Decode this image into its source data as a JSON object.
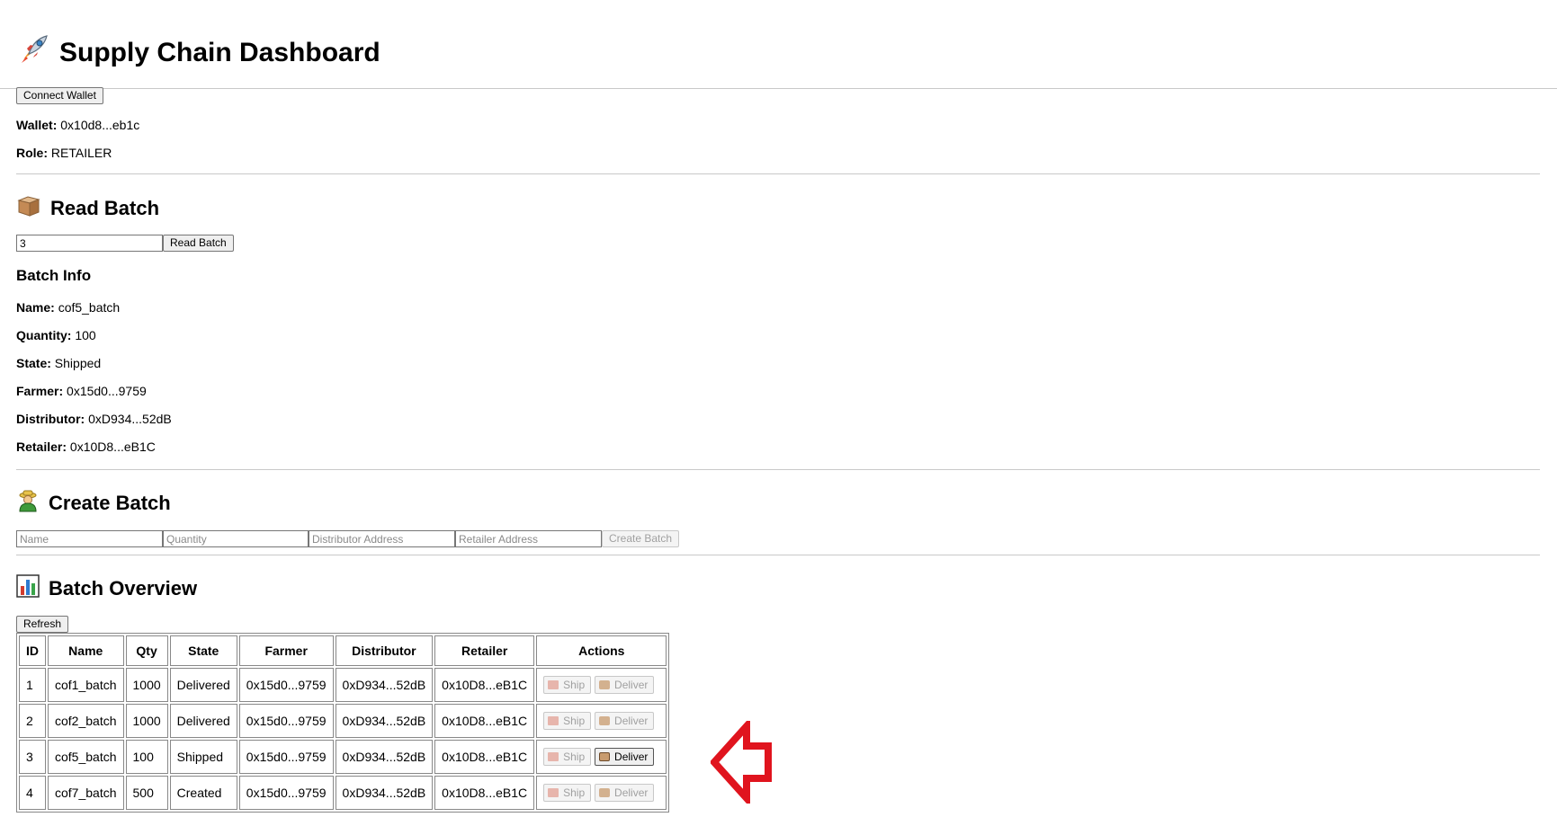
{
  "header": {
    "title": "Supply Chain Dashboard",
    "icon": "rocket-icon"
  },
  "wallet": {
    "connect_label": "Connect Wallet",
    "wallet_label": "Wallet:",
    "wallet_value": "0x10d8...eb1c",
    "role_label": "Role:",
    "role_value": "RETAILER"
  },
  "read_batch": {
    "heading": "Read Batch",
    "icon": "package-icon",
    "input_value": "3",
    "button_label": "Read Batch",
    "info_heading": "Batch Info",
    "fields": [
      {
        "label": "Name:",
        "value": "cof5_batch"
      },
      {
        "label": "Quantity:",
        "value": "100"
      },
      {
        "label": "State:",
        "value": "Shipped"
      },
      {
        "label": "Farmer:",
        "value": "0x15d0...9759"
      },
      {
        "label": "Distributor:",
        "value": "0xD934...52dB"
      },
      {
        "label": "Retailer:",
        "value": "0x10D8...eB1C"
      }
    ]
  },
  "create_batch": {
    "heading": "Create Batch",
    "icon": "farmer-icon",
    "name_placeholder": "Name",
    "quantity_placeholder": "Quantity",
    "distributor_placeholder": "Distributor Address",
    "retailer_placeholder": "Retailer Address",
    "button_label": "Create Batch"
  },
  "overview": {
    "heading": "Batch Overview",
    "icon": "bar-chart-icon",
    "refresh_label": "Refresh",
    "columns": [
      "ID",
      "Name",
      "Qty",
      "State",
      "Farmer",
      "Distributor",
      "Retailer",
      "Actions"
    ],
    "ship_label": "Ship",
    "deliver_label": "Deliver",
    "rows": [
      {
        "id": "1",
        "name": "cof1_batch",
        "qty": "1000",
        "state": "Delivered",
        "farmer": "0x15d0...9759",
        "distributor": "0xD934...52dB",
        "retailer": "0x10D8...eB1C",
        "ship_enabled": false,
        "deliver_enabled": false
      },
      {
        "id": "2",
        "name": "cof2_batch",
        "qty": "1000",
        "state": "Delivered",
        "farmer": "0x15d0...9759",
        "distributor": "0xD934...52dB",
        "retailer": "0x10D8...eB1C",
        "ship_enabled": false,
        "deliver_enabled": false
      },
      {
        "id": "3",
        "name": "cof5_batch",
        "qty": "100",
        "state": "Shipped",
        "farmer": "0x15d0...9759",
        "distributor": "0xD934...52dB",
        "retailer": "0x10D8...eB1C",
        "ship_enabled": false,
        "deliver_enabled": true
      },
      {
        "id": "4",
        "name": "cof7_batch",
        "qty": "500",
        "state": "Created",
        "farmer": "0x15d0...9759",
        "distributor": "0xD934...52dB",
        "retailer": "0x10D8...eB1C",
        "ship_enabled": false,
        "deliver_enabled": false
      }
    ]
  },
  "annotation": {
    "icon": "red-arrow-left-icon",
    "color": "#e0141e"
  }
}
